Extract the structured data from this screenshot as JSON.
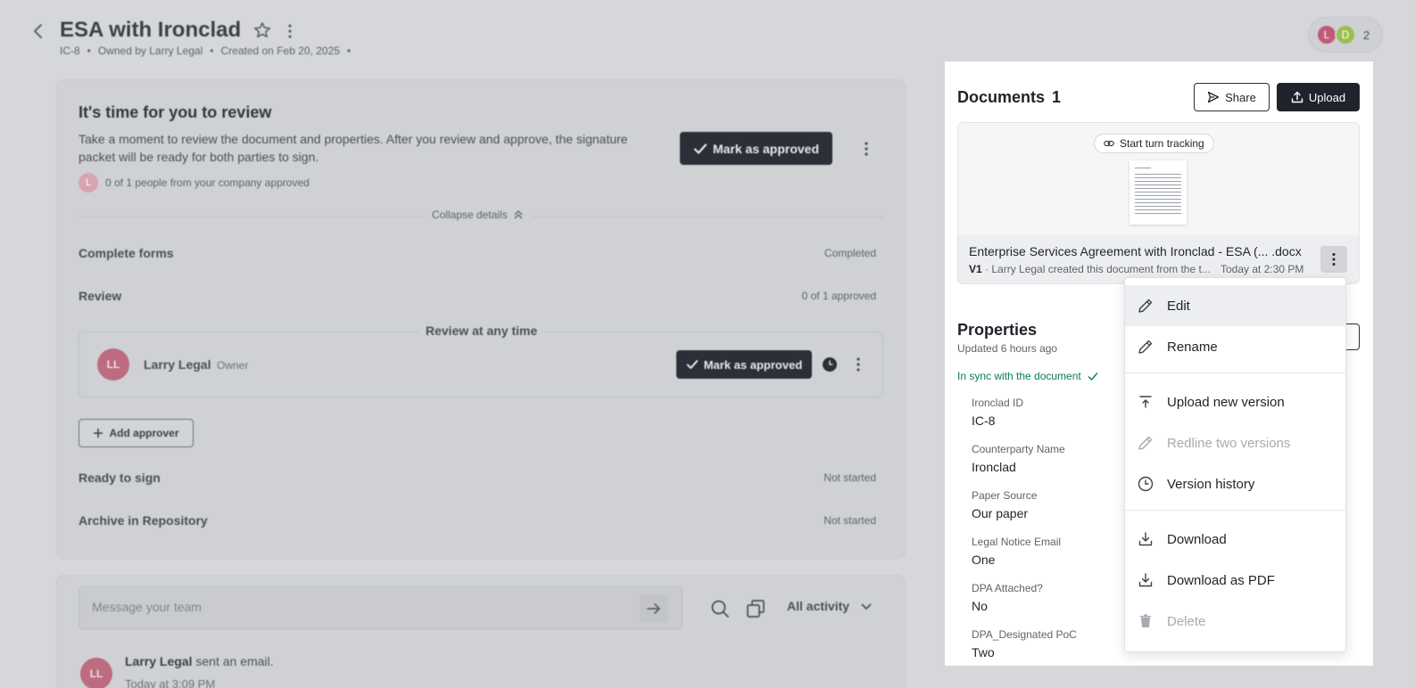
{
  "header": {
    "title": "ESA with Ironclad",
    "meta": [
      "IC-8",
      "Owned by Larry Legal",
      "Created on Feb 20, 2025"
    ],
    "collaborators": [
      {
        "initial": "L",
        "color": "#c05a78"
      },
      {
        "initial": "D",
        "color": "#9bbf4f"
      }
    ],
    "collaborator_count": "2"
  },
  "review": {
    "title": "It's time for you to review",
    "description": "Take a moment to review the document and properties. After you review and approve, the signature packet will be ready for both parties to sign.",
    "mark_approved_label": "Mark as approved",
    "approved_avatar": "L",
    "approved_status": "0 of 1 people from your company approved",
    "collapse_label": "Collapse details",
    "steps": [
      {
        "label": "Complete forms",
        "status": "Completed"
      },
      {
        "label": "Review",
        "status": "0 of 1 approved"
      },
      {
        "label": "Ready to sign",
        "status": "Not started"
      },
      {
        "label": "Archive in Repository",
        "status": "Not started"
      }
    ],
    "reviewer_group_caption": "Review at any time",
    "reviewer": {
      "initials": "LL",
      "name": "Larry Legal",
      "role": "Owner",
      "action": "Mark as approved"
    },
    "add_approver_label": "Add approver"
  },
  "activity": {
    "message_placeholder": "Message your team",
    "filter_label": "All activity",
    "feed": [
      {
        "initials": "LL",
        "actor": "Larry Legal",
        "action": "sent an email.",
        "time": "Today at 3:09 PM"
      }
    ]
  },
  "documents": {
    "title": "Documents",
    "count": "1",
    "share_label": "Share",
    "upload_label": "Upload",
    "turn_tracking_label": "Start turn tracking",
    "file": {
      "name": "Enterprise Services Agreement with Ironclad - ESA (... .docx",
      "version": "V1",
      "note": "Larry Legal created this document from the t...",
      "time": "Today at 2:30 PM"
    }
  },
  "properties": {
    "title": "Properties",
    "updated": "Updated 6 hours ago",
    "sync_status": "In sync with the document",
    "fields": [
      {
        "label": "Ironclad ID",
        "value": "IC-8"
      },
      {
        "label": "Counterparty Name",
        "value": "Ironclad"
      },
      {
        "label": "Paper Source",
        "value": "Our paper"
      },
      {
        "label": "Legal Notice Email",
        "value": "One"
      },
      {
        "label": "DPA Attached?",
        "value": "No"
      },
      {
        "label": "DPA_Designated PoC",
        "value": "Two"
      }
    ]
  },
  "context_menu": {
    "items": [
      {
        "label": "Edit",
        "icon": "pencil-icon",
        "disabled": false
      },
      {
        "label": "Rename",
        "icon": "pencil-icon",
        "disabled": false
      },
      {
        "label": "Upload new version",
        "icon": "upload-version-icon",
        "disabled": false
      },
      {
        "label": "Redline two versions",
        "icon": "pencil-icon",
        "disabled": true
      },
      {
        "label": "Version history",
        "icon": "clock-icon",
        "disabled": false
      },
      {
        "label": "Download",
        "icon": "download-icon",
        "disabled": false
      },
      {
        "label": "Download as PDF",
        "icon": "download-icon",
        "disabled": false
      },
      {
        "label": "Delete",
        "icon": "trash-icon",
        "disabled": true
      }
    ]
  },
  "colors": {
    "dark_button": "#1f242c",
    "sync_green": "#0a7d4b",
    "avatar_pink": "#bd6b80"
  }
}
